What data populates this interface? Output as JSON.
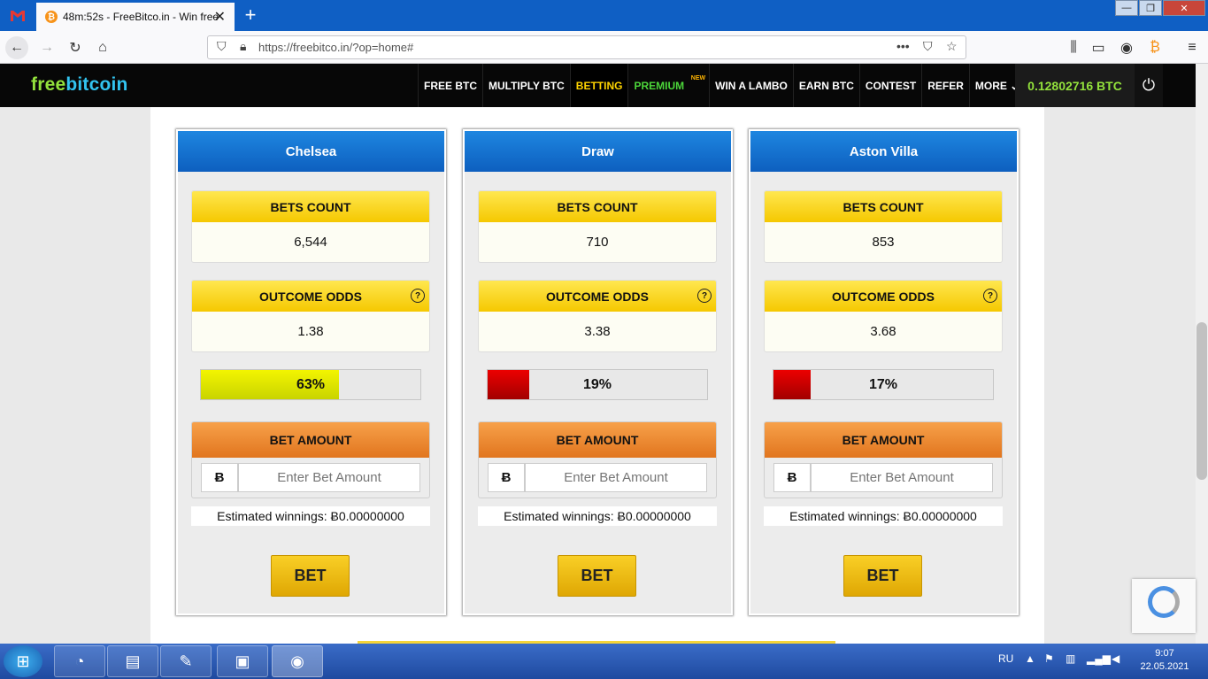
{
  "browser": {
    "tab_title": "48m:52s - FreeBitco.in - Win free",
    "tab_close": "✕",
    "new_tab": "+",
    "url": "https://freebitco.in/?op=home#",
    "win_controls": [
      "—",
      "❐",
      "✕"
    ]
  },
  "site": {
    "logo_part1": "free",
    "logo_part2": "bitcoin",
    "menu": [
      {
        "label": "FREE BTC"
      },
      {
        "label": "MULTIPLY BTC"
      },
      {
        "label": "BETTING"
      },
      {
        "label": "PREMIUM",
        "badge": "NEW"
      },
      {
        "label": "WIN A LAMBO"
      },
      {
        "label": "EARN BTC"
      },
      {
        "label": "CONTEST"
      },
      {
        "label": "REFER"
      },
      {
        "label": "MORE ⌄"
      }
    ],
    "balance": "0.12802716 BTC",
    "power_icon": "⏻"
  },
  "outcomes": [
    {
      "team": "Chelsea",
      "bets_count_label": "BETS COUNT",
      "bets_count": "6,544",
      "odds_label": "OUTCOME ODDS",
      "odds": "1.38",
      "percent_text": "63%",
      "percent": 63,
      "bar_color": "yellow",
      "bet_amount_label": "BET AMOUNT",
      "btc_symbol": "Ƀ",
      "placeholder": "Enter Bet Amount",
      "estimated": "Estimated winnings: Ƀ0.00000000",
      "bet_button": "BET"
    },
    {
      "team": "Draw",
      "bets_count_label": "BETS COUNT",
      "bets_count": "710",
      "odds_label": "OUTCOME ODDS",
      "odds": "3.38",
      "percent_text": "19%",
      "percent": 19,
      "bar_color": "red",
      "bet_amount_label": "BET AMOUNT",
      "btc_symbol": "Ƀ",
      "placeholder": "Enter Bet Amount",
      "estimated": "Estimated winnings: Ƀ0.00000000",
      "bet_button": "BET"
    },
    {
      "team": "Aston Villa",
      "bets_count_label": "BETS COUNT",
      "bets_count": "853",
      "odds_label": "OUTCOME ODDS",
      "odds": "3.68",
      "percent_text": "17%",
      "percent": 17,
      "bar_color": "red",
      "bet_amount_label": "BET AMOUNT",
      "btc_symbol": "Ƀ",
      "placeholder": "Enter Bet Amount",
      "estimated": "Estimated winnings: Ƀ0.00000000",
      "bet_button": "BET"
    }
  ],
  "colors": {
    "header_blue": "#0d5fbf",
    "yellow": "#f5c800",
    "orange": "#e1751e",
    "balance_green": "#93e23c"
  },
  "taskbar": {
    "lang": "RU",
    "time": "9:07",
    "date": "22.05.2021"
  }
}
